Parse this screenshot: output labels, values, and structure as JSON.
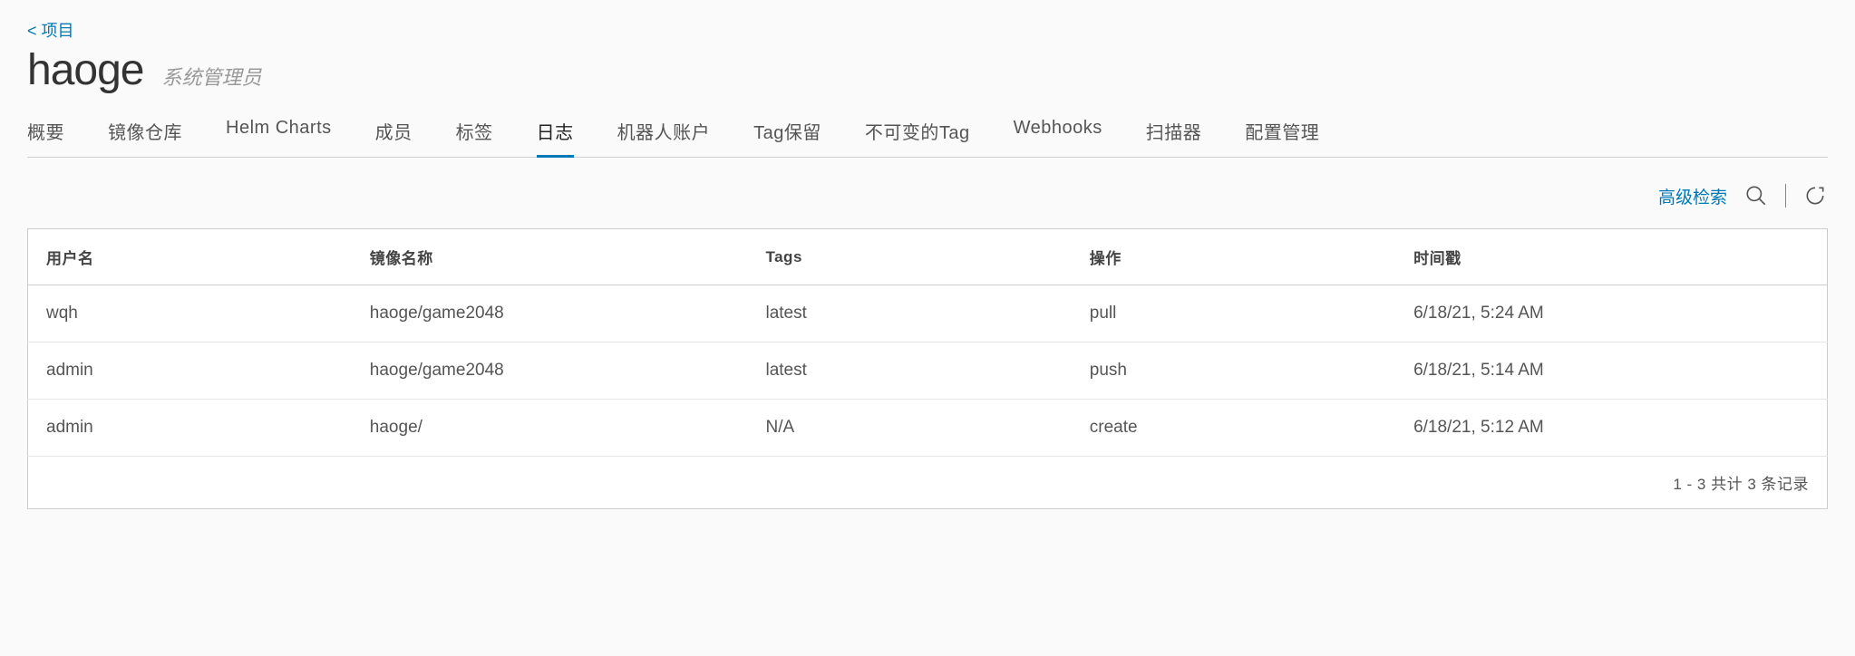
{
  "breadcrumb": "< 项目",
  "title": "haoge",
  "role": "系统管理员",
  "tabs": [
    {
      "label": "概要"
    },
    {
      "label": "镜像仓库"
    },
    {
      "label": "Helm Charts"
    },
    {
      "label": "成员"
    },
    {
      "label": "标签"
    },
    {
      "label": "日志"
    },
    {
      "label": "机器人账户"
    },
    {
      "label": "Tag保留"
    },
    {
      "label": "不可变的Tag"
    },
    {
      "label": "Webhooks"
    },
    {
      "label": "扫描器"
    },
    {
      "label": "配置管理"
    }
  ],
  "active_tab_index": 5,
  "toolbar": {
    "adv_search": "高级检索"
  },
  "table": {
    "headers": {
      "user": "用户名",
      "image": "镜像名称",
      "tags": "Tags",
      "operation": "操作",
      "timestamp": "时间戳"
    },
    "rows": [
      {
        "user": "wqh",
        "image": "haoge/game2048",
        "tags": "latest",
        "operation": "pull",
        "timestamp": "6/18/21, 5:24 AM"
      },
      {
        "user": "admin",
        "image": "haoge/game2048",
        "tags": "latest",
        "operation": "push",
        "timestamp": "6/18/21, 5:14 AM"
      },
      {
        "user": "admin",
        "image": "haoge/",
        "tags": "N/A",
        "operation": "create",
        "timestamp": "6/18/21, 5:12 AM"
      }
    ],
    "footer": "1 - 3 共计 3 条记录"
  }
}
